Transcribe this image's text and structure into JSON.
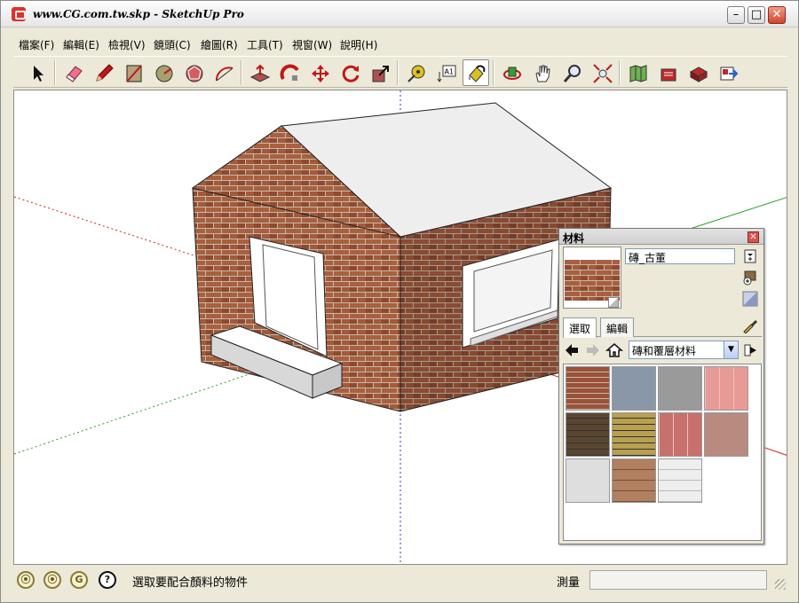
{
  "window": {
    "title": "www.CG.com.tw.skp - SketchUp Pro",
    "buttons": {
      "minimize": "–",
      "maximize": "□",
      "close": "✕"
    }
  },
  "menu": [
    {
      "label": "檔案(F)"
    },
    {
      "label": "編輯(E)"
    },
    {
      "label": "檢視(V)"
    },
    {
      "label": "鏡頭(C)"
    },
    {
      "label": "繪圖(R)"
    },
    {
      "label": "工具(T)"
    },
    {
      "label": "視窗(W)"
    },
    {
      "label": "說明(H)"
    }
  ],
  "toolbar": {
    "tools": [
      "select-tool",
      "eraser-tool",
      "pencil-tool",
      "rectangle-tool",
      "circle-tool",
      "polygon-tool",
      "arc-tool",
      "push-pull-tool",
      "follow-me-tool",
      "move-tool",
      "rotate-tool",
      "scale-tool",
      "tape-measure-tool",
      "text-tool",
      "paint-bucket-tool",
      "orbit-tool",
      "pan-tool",
      "zoom-tool",
      "zoom-extents-tool",
      "location-tool",
      "get-models-tool",
      "share-model-tool",
      "components-tool",
      "export-tool"
    ],
    "active_tool": "paint-bucket-tool",
    "text_tool_label": "A1"
  },
  "status": {
    "message": "選取要配合顏料的物件",
    "measure_label": "測量",
    "measure_value": "",
    "help": "?",
    "geo": "G"
  },
  "materials_panel": {
    "title": "材料",
    "close": "✕",
    "material_name": "磚_古董",
    "tabs": [
      {
        "label": "選取",
        "selected": true
      },
      {
        "label": "編輯",
        "selected": false
      }
    ],
    "collection": "磚和覆層材料",
    "dropdown_arrow": "▼",
    "swatches": [
      {
        "name": "brick-antique",
        "color": "#8b4a33"
      },
      {
        "name": "stone-blue-gray",
        "color": "#8a97a8"
      },
      {
        "name": "slate-gray",
        "color": "#9a9a9a"
      },
      {
        "name": "tile-pink",
        "color": "#e89a96"
      },
      {
        "name": "brick-dark",
        "color": "#5a4630"
      },
      {
        "name": "brick-yellow",
        "color": "#b8a050"
      },
      {
        "name": "tile-red",
        "color": "#c8706c"
      },
      {
        "name": "paver-rose",
        "color": "#b88a80"
      },
      {
        "name": "stucco-light",
        "color": "#dedede"
      },
      {
        "name": "siding-wood",
        "color": "#b08060"
      },
      {
        "name": "siding-white",
        "color": "#eeeeee"
      }
    ]
  },
  "colors": {
    "brick": "#9a5238",
    "roof": "#eeeeee",
    "axis_red": "#d02020",
    "axis_green": "#20a020",
    "axis_blue": "#3030c0"
  }
}
